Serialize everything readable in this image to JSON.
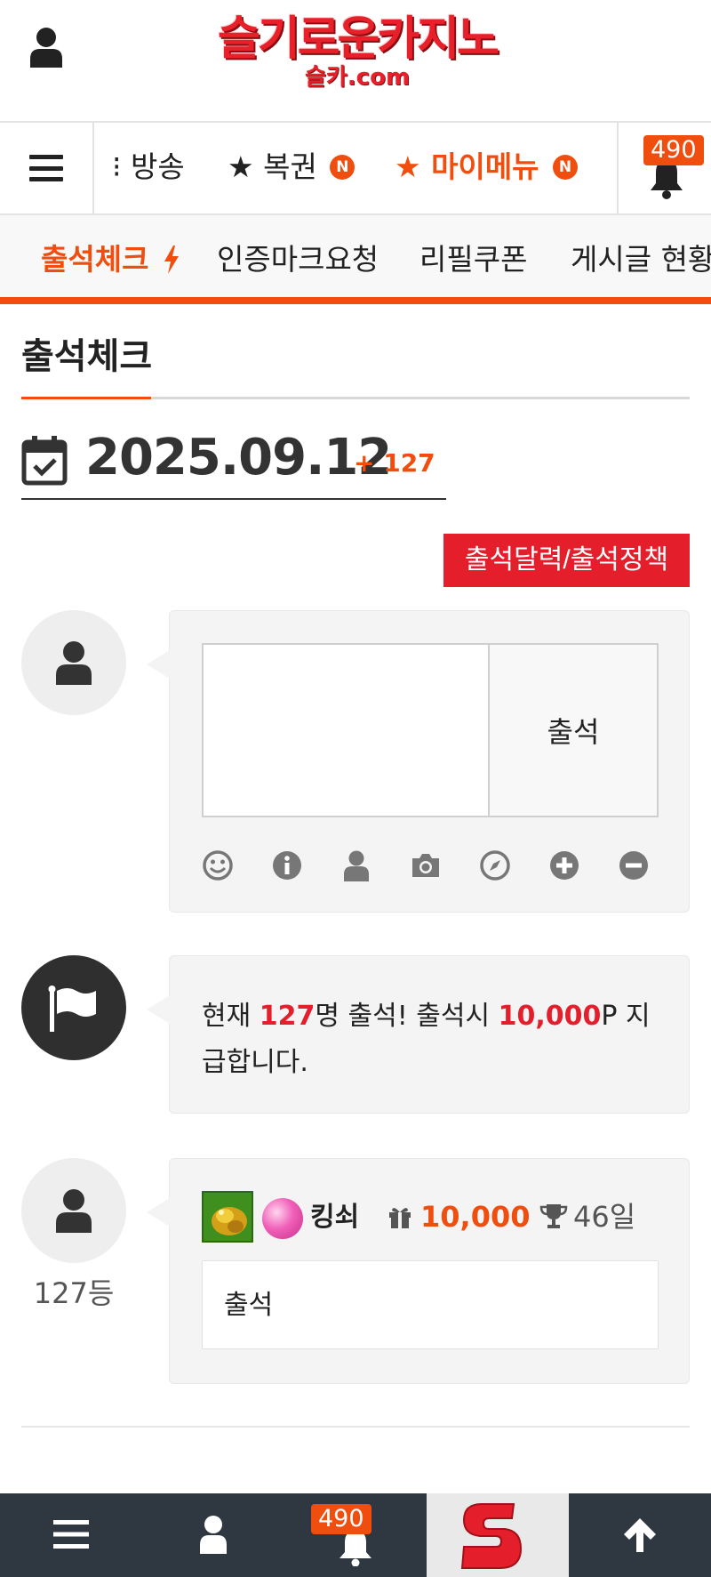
{
  "header": {
    "logo_main": "슬기로운카지노",
    "logo_sub": "슬카.com"
  },
  "nav_primary": {
    "items": [
      {
        "label": "방송",
        "prefix": "⁝"
      },
      {
        "label": "복권",
        "prefix": "★",
        "badge": "N"
      },
      {
        "label": "마이메뉴",
        "prefix": "★",
        "badge": "N",
        "active": true
      }
    ],
    "notification_count": "490"
  },
  "nav_secondary": {
    "items": [
      {
        "label": "출석체크",
        "active": true
      },
      {
        "label": "인증마크요청"
      },
      {
        "label": "리필쿠폰"
      },
      {
        "label": "게시글 현황"
      }
    ]
  },
  "page": {
    "title": "출석체크",
    "date": "2025.09.12",
    "date_delta": "+ 127",
    "policy_button": "출석달력/출석정책"
  },
  "comment_form": {
    "textarea_value": "",
    "submit_label": "출석",
    "tools": [
      "emoji-icon",
      "info-icon",
      "user-icon",
      "camera-icon",
      "compass-icon",
      "plus-circle-icon",
      "minus-circle-icon"
    ]
  },
  "notice": {
    "prefix": "현재 ",
    "count": "127",
    "mid": "명 출석! 출석시 ",
    "points": "10,000",
    "suffix": "P 지급합니다."
  },
  "entry": {
    "nickname": "킹쇠",
    "points": "10,000",
    "days": "46일",
    "message": "출석",
    "rank": "127등"
  },
  "bottom_bar": {
    "notification_count": "490",
    "icons": [
      "menu-icon",
      "user-icon",
      "bell-icon",
      "site-logo",
      "arrow-up-icon"
    ]
  },
  "colors": {
    "accent": "#f04e0f",
    "red": "#e41e2b",
    "bottom_bar": "#2f3740"
  }
}
